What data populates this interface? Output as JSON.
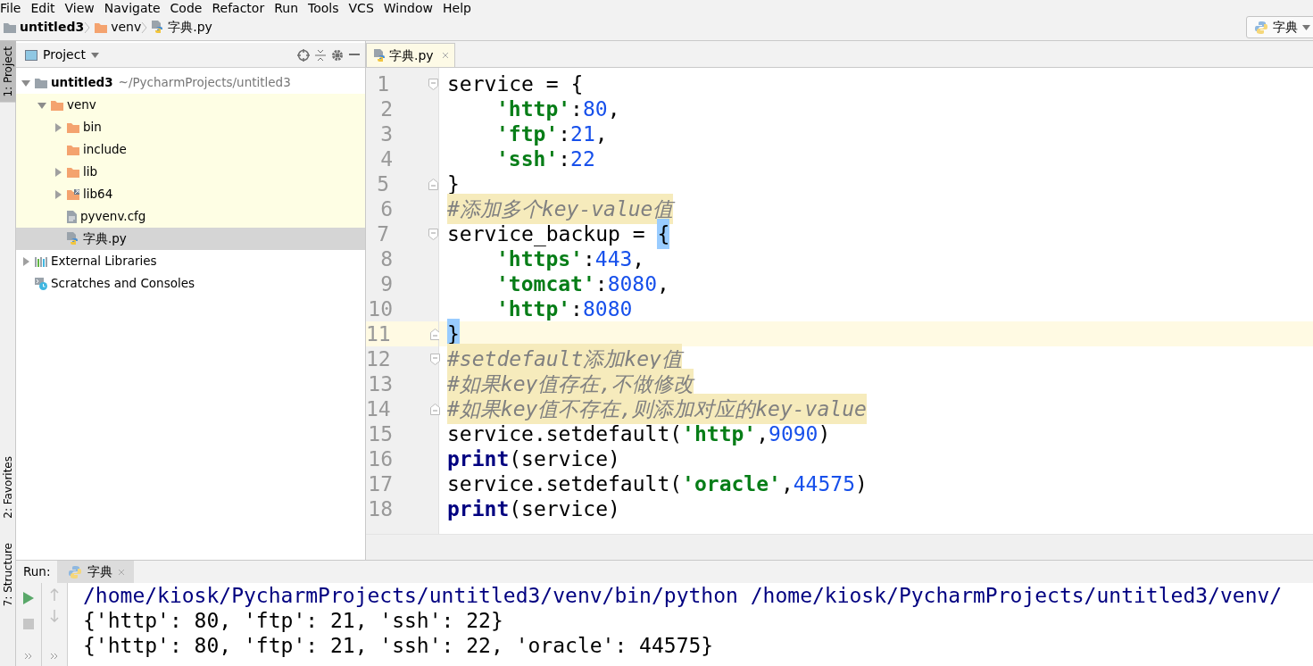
{
  "menu": [
    "File",
    "Edit",
    "View",
    "Navigate",
    "Code",
    "Refactor",
    "Run",
    "Tools",
    "VCS",
    "Window",
    "Help"
  ],
  "breadcrumbs": [
    {
      "label": "untitled3",
      "kind": "project"
    },
    {
      "label": "venv",
      "kind": "folder"
    },
    {
      "label": "字典.py",
      "kind": "python"
    }
  ],
  "run_config": {
    "label": "字典"
  },
  "side_strip": [
    {
      "label": "1: Project",
      "selected": true
    },
    {
      "label": "2: Favorites",
      "selected": false
    },
    {
      "label": "7: Structure",
      "selected": false
    }
  ],
  "project_panel": {
    "title": "Project",
    "tree": [
      {
        "label": "untitled3",
        "path": "~/PycharmProjects/untitled3",
        "kind": "project",
        "expanded": true,
        "selected": false,
        "children": [
          {
            "label": "venv",
            "kind": "folder",
            "expanded": true,
            "excluded": true,
            "selected": false,
            "children": [
              {
                "label": "bin",
                "kind": "folder",
                "expanded": false,
                "selected": false
              },
              {
                "label": "include",
                "kind": "folder",
                "selected": false
              },
              {
                "label": "lib",
                "kind": "folder",
                "expanded": false,
                "selected": false
              },
              {
                "label": "lib64",
                "kind": "folder_link",
                "expanded": false,
                "selected": false
              },
              {
                "label": "pyvenv.cfg",
                "kind": "file",
                "selected": false
              },
              {
                "label": "字典.py",
                "kind": "python",
                "selected": true
              }
            ]
          }
        ]
      },
      {
        "label": "External Libraries",
        "kind": "libraries",
        "expanded": false,
        "selected": false
      },
      {
        "label": "Scratches and Consoles",
        "kind": "scratches",
        "selected": false
      }
    ]
  },
  "editor": {
    "tabs": [
      {
        "label": "字典.py",
        "selected": true
      }
    ],
    "lines": [
      {
        "number": "1",
        "fold_open": true,
        "tokens": [
          {
            "kind": "plain",
            "text": "service = {"
          }
        ]
      },
      {
        "number": "2",
        "indented": true,
        "tokens": [
          {
            "kind": "string",
            "text": "'http'"
          },
          {
            "kind": "plain",
            "text": ":"
          },
          {
            "kind": "number",
            "text": "80"
          },
          {
            "kind": "plain",
            "text": ","
          }
        ]
      },
      {
        "number": "3",
        "indented": true,
        "tokens": [
          {
            "kind": "string",
            "text": "'ftp'"
          },
          {
            "kind": "plain",
            "text": ":"
          },
          {
            "kind": "number",
            "text": "21"
          },
          {
            "kind": "plain",
            "text": ","
          }
        ]
      },
      {
        "number": "4",
        "indented": true,
        "tokens": [
          {
            "kind": "string",
            "text": "'ssh'"
          },
          {
            "kind": "plain",
            "text": ":"
          },
          {
            "kind": "number",
            "text": "22"
          }
        ]
      },
      {
        "number": "5",
        "fold_close": true,
        "tokens": [
          {
            "kind": "plain",
            "text": "}"
          }
        ]
      },
      {
        "number": "6",
        "tokens": [
          {
            "kind": "comment",
            "text": "#添加多个key-value值"
          }
        ]
      },
      {
        "number": "7",
        "fold_open": true,
        "tokens": [
          {
            "kind": "plain",
            "text": "service_backup = "
          },
          {
            "kind": "brace_match",
            "text": "{"
          }
        ]
      },
      {
        "number": "8",
        "indented": true,
        "tokens": [
          {
            "kind": "string",
            "text": "'https'"
          },
          {
            "kind": "plain",
            "text": ":"
          },
          {
            "kind": "number",
            "text": "443"
          },
          {
            "kind": "plain",
            "text": ","
          }
        ]
      },
      {
        "number": "9",
        "indented": true,
        "tokens": [
          {
            "kind": "string",
            "text": "'tomcat'"
          },
          {
            "kind": "plain",
            "text": ":"
          },
          {
            "kind": "number",
            "text": "8080"
          },
          {
            "kind": "plain",
            "text": ","
          }
        ]
      },
      {
        "number": "10",
        "indented": true,
        "tokens": [
          {
            "kind": "string",
            "text": "'http'"
          },
          {
            "kind": "plain",
            "text": ":"
          },
          {
            "kind": "number",
            "text": "8080"
          }
        ]
      },
      {
        "number": "11",
        "fold_close": true,
        "current": true,
        "tokens": [
          {
            "kind": "brace_match",
            "text": "}"
          }
        ]
      },
      {
        "number": "12",
        "fold_open": true,
        "tokens": [
          {
            "kind": "comment",
            "text": "#setdefault添加key值"
          }
        ]
      },
      {
        "number": "13",
        "tokens": [
          {
            "kind": "comment",
            "text": "#如果key值存在,不做修改"
          }
        ]
      },
      {
        "number": "14",
        "fold_close": true,
        "tokens": [
          {
            "kind": "comment",
            "text": "#如果key值不存在,则添加对应的key-value"
          }
        ]
      },
      {
        "number": "15",
        "tokens": [
          {
            "kind": "plain",
            "text": "service.setdefault("
          },
          {
            "kind": "string",
            "text": "'http'"
          },
          {
            "kind": "plain",
            "text": ","
          },
          {
            "kind": "number",
            "text": "9090"
          },
          {
            "kind": "plain",
            "text": ")"
          }
        ]
      },
      {
        "number": "16",
        "tokens": [
          {
            "kind": "keyword",
            "text": "print"
          },
          {
            "kind": "plain",
            "text": "(service)"
          }
        ]
      },
      {
        "number": "17",
        "tokens": [
          {
            "kind": "plain",
            "text": "service.setdefault("
          },
          {
            "kind": "string",
            "text": "'oracle'"
          },
          {
            "kind": "plain",
            "text": ","
          },
          {
            "kind": "number",
            "text": "44575"
          },
          {
            "kind": "plain",
            "text": ")"
          }
        ]
      },
      {
        "number": "18",
        "tokens": [
          {
            "kind": "keyword",
            "text": "print"
          },
          {
            "kind": "plain",
            "text": "(service)"
          }
        ]
      }
    ]
  },
  "run_panel": {
    "label": "Run:",
    "tabs": [
      {
        "label": "字典",
        "selected": true
      }
    ],
    "console": [
      {
        "kind": "command",
        "text": "/home/kiosk/PycharmProjects/untitled3/venv/bin/python /home/kiosk/PycharmProjects/untitled3/venv/"
      },
      {
        "kind": "output",
        "text": "{'http': 80, 'ftp': 21, 'ssh': 22}"
      },
      {
        "kind": "output",
        "text": "{'http': 80, 'ftp': 21, 'ssh': 22, 'oracle': 44575}"
      }
    ]
  }
}
